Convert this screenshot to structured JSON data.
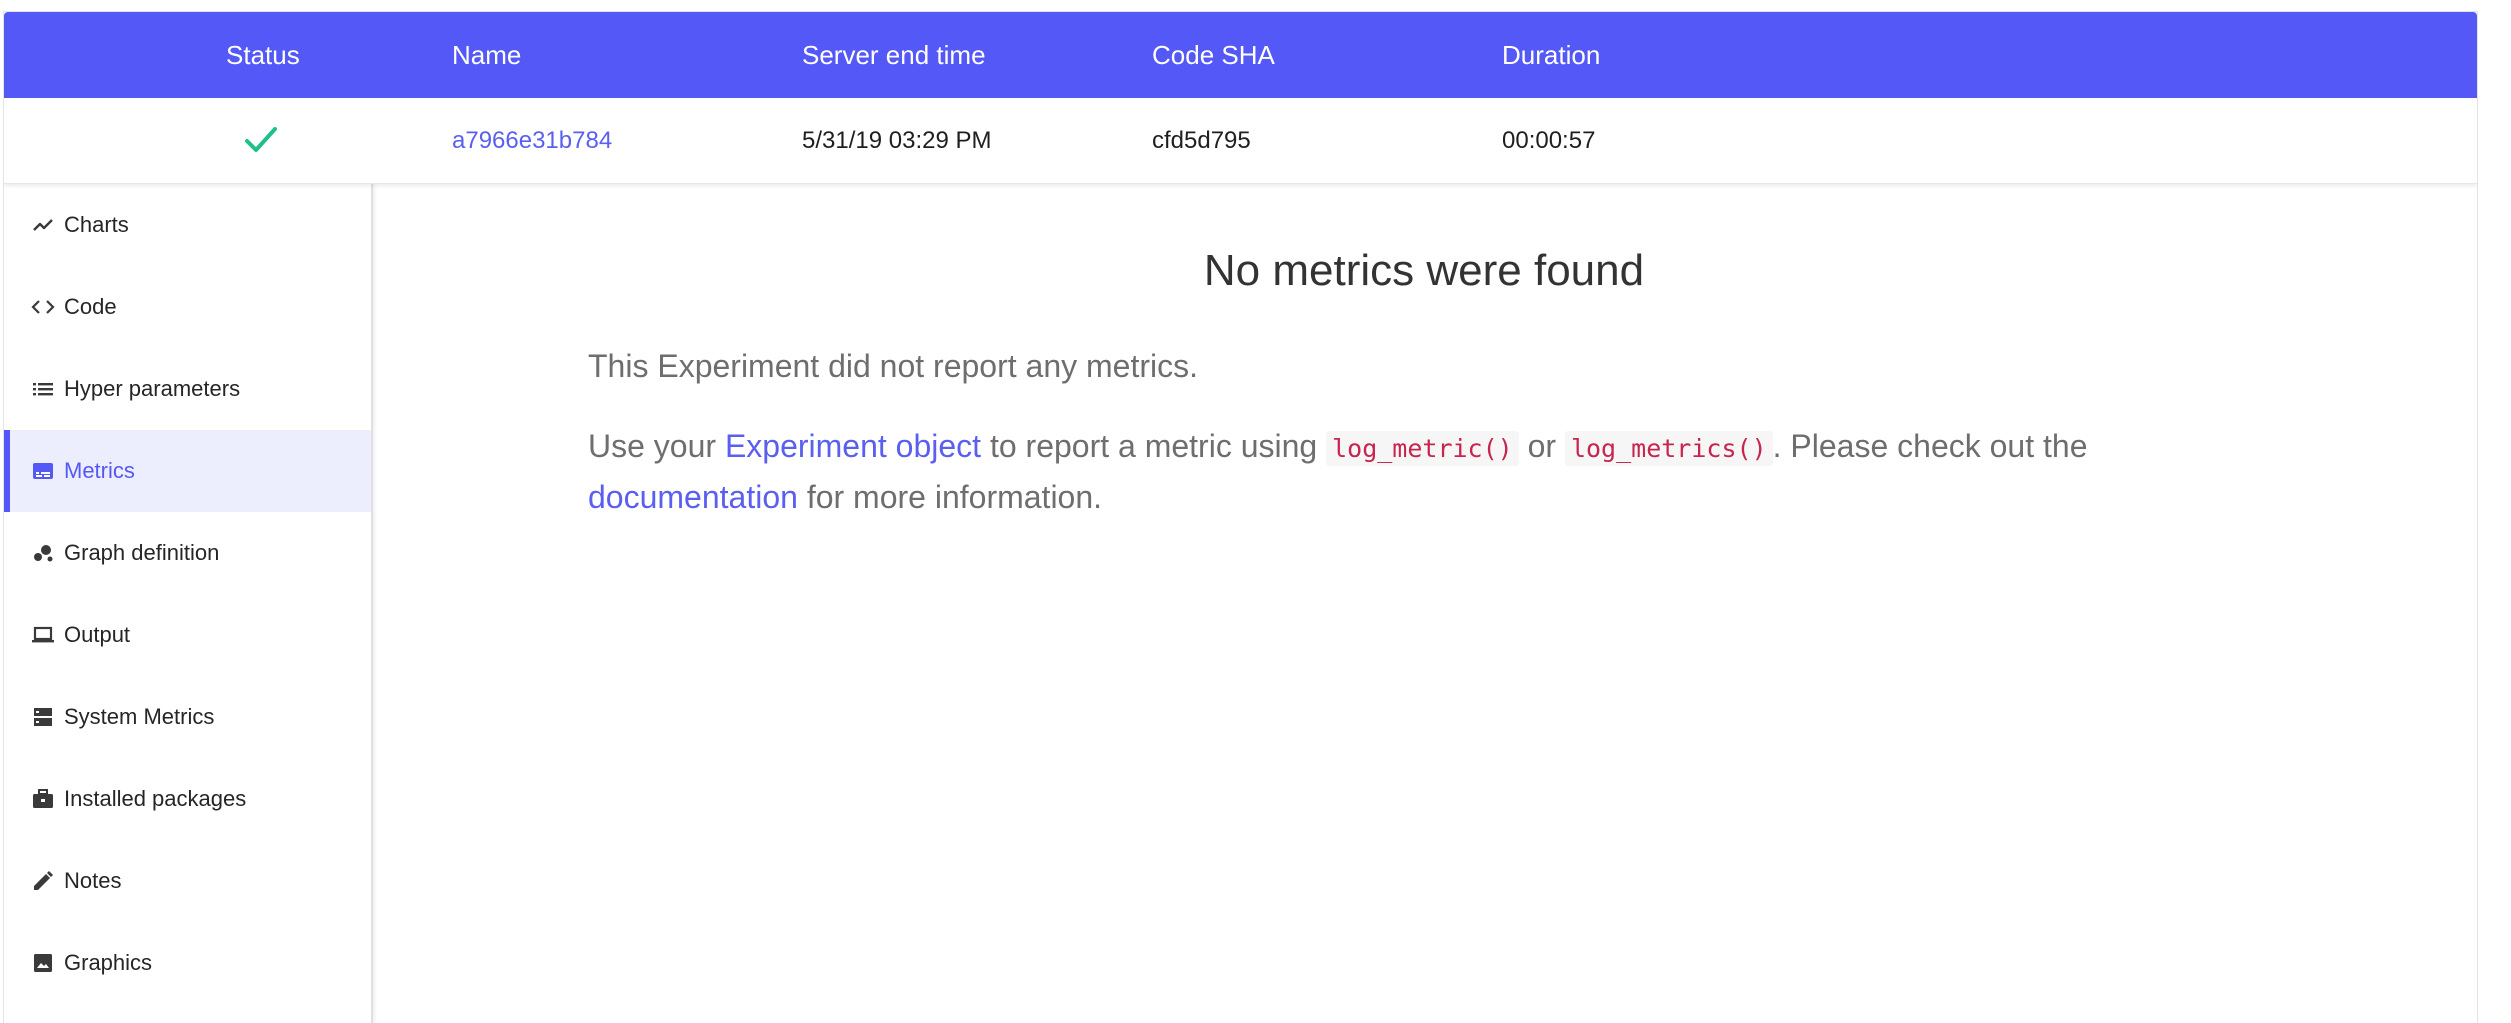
{
  "table": {
    "headers": {
      "status": "Status",
      "name": "Name",
      "server_end_time": "Server end time",
      "code_sha": "Code SHA",
      "duration": "Duration"
    },
    "row": {
      "status_icon": "check-icon",
      "name": "a7966e31b784",
      "server_end_time": "5/31/19 03:29 PM",
      "code_sha": "cfd5d795",
      "duration": "00:00:57"
    }
  },
  "sidebar": {
    "items": [
      {
        "label": "Charts",
        "icon": "chart-line-icon",
        "active": false
      },
      {
        "label": "Code",
        "icon": "code-icon",
        "active": false
      },
      {
        "label": "Hyper parameters",
        "icon": "list-icon",
        "active": false
      },
      {
        "label": "Metrics",
        "icon": "metrics-icon",
        "active": true
      },
      {
        "label": "Graph definition",
        "icon": "graph-icon",
        "active": false
      },
      {
        "label": "Output",
        "icon": "laptop-icon",
        "active": false
      },
      {
        "label": "System Metrics",
        "icon": "server-icon",
        "active": false
      },
      {
        "label": "Installed packages",
        "icon": "briefcase-icon",
        "active": false
      },
      {
        "label": "Notes",
        "icon": "pencil-icon",
        "active": false
      },
      {
        "label": "Graphics",
        "icon": "image-icon",
        "active": false
      }
    ]
  },
  "main": {
    "title": "No metrics were found",
    "line1": "This Experiment did not report any metrics.",
    "p2_prefix": "Use your ",
    "p2_link_experiment": "Experiment object",
    "p2_mid1": " to report a metric using ",
    "p2_code1": "log_metric()",
    "p2_mid2": " or ",
    "p2_code2": "log_metrics()",
    "p2_mid3": ". Please check out the ",
    "p2_link_docs": "documentation",
    "p2_suffix": " for more information."
  },
  "colors": {
    "accent": "#5458f6",
    "success": "#1fbf8f",
    "link": "#5a5ff0",
    "code": "#c7254e"
  }
}
